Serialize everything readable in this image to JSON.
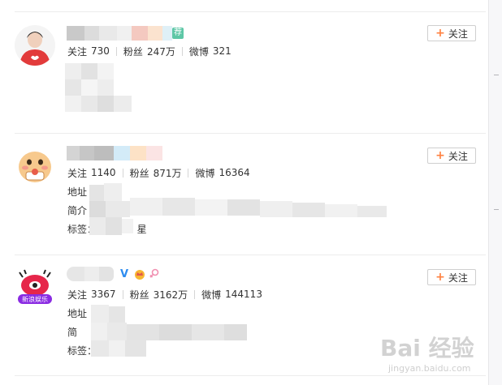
{
  "users": [
    {
      "follow_label": "关注",
      "stats": {
        "following_label": "关注",
        "following": "730",
        "fans_label": "粉丝",
        "fans": "247万",
        "weibo_label": "微博",
        "weibo": "321"
      }
    },
    {
      "follow_label": "关注",
      "stats": {
        "following_label": "关注",
        "following": "1140",
        "fans_label": "粉丝",
        "fans": "871万",
        "weibo_label": "微博",
        "weibo": "16364"
      },
      "location_label": "地址",
      "intro_label": "简介",
      "tags_label": "标签：",
      "tags_tail": "星"
    },
    {
      "follow_label": "关注",
      "stats": {
        "following_label": "关注",
        "following": "3367",
        "fans_label": "粉丝",
        "fans": "3162万",
        "weibo_label": "微博",
        "weibo": "144113"
      },
      "location_label": "地址",
      "intro_label": "简",
      "tags_label": "标签："
    }
  ],
  "badges": {
    "tag_pill": "荐",
    "vip": "V"
  },
  "avatar_text": "新浪娱乐",
  "watermark": {
    "brand": "Bai 经验",
    "url": "jingyan.baidu.com"
  },
  "colors": {
    "accent_orange": "#ff8140",
    "vip_blue": "#2d8cf0",
    "tag_green": "#5dc7a6",
    "divider": "#ececec"
  }
}
